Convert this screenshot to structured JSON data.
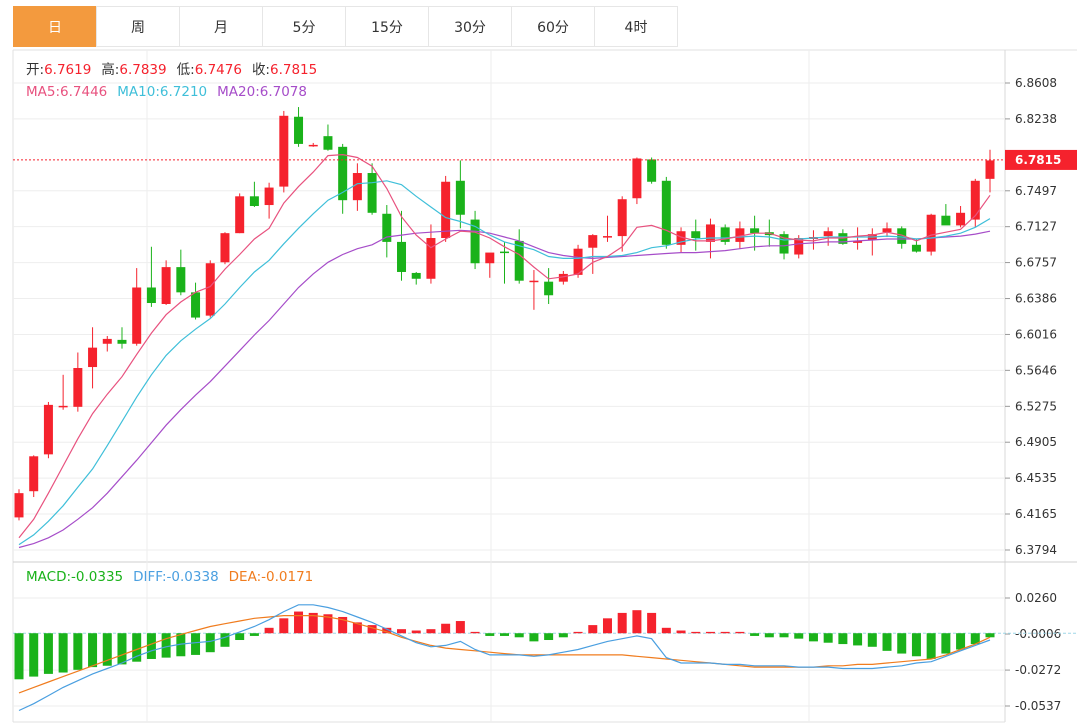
{
  "tabs": [
    {
      "label": "日",
      "active": true
    },
    {
      "label": "周",
      "active": false
    },
    {
      "label": "月",
      "active": false
    },
    {
      "label": "5分",
      "active": false
    },
    {
      "label": "15分",
      "active": false
    },
    {
      "label": "30分",
      "active": false
    },
    {
      "label": "60分",
      "active": false
    },
    {
      "label": "4时",
      "active": false
    }
  ],
  "colors": {
    "up": "#f5222d",
    "down": "#1ab21a",
    "ma5": "#e8527f",
    "ma10": "#3fbfd9",
    "ma20": "#a64dc9",
    "diff": "#4a9fe0",
    "dea": "#f07c1e",
    "grid": "#eeeeee",
    "tab_active": "#f39a3e"
  },
  "chart_data": [
    {
      "type": "candlestick",
      "ohlc_header": [
        {
          "label": "开:",
          "value": "6.7619"
        },
        {
          "label": "高:",
          "value": "6.7839"
        },
        {
          "label": "低:",
          "value": "6.7476"
        },
        {
          "label": "收:",
          "value": "6.7815"
        }
      ],
      "ma_header": [
        {
          "label": "MA5:",
          "value": "6.7446",
          "color": "#e8527f"
        },
        {
          "label": "MA10:",
          "value": "6.7210",
          "color": "#3fbfd9"
        },
        {
          "label": "MA20:",
          "value": "6.7078",
          "color": "#a64dc9"
        }
      ],
      "y_ticks": [
        "6.8608",
        "6.8238",
        "6.7497",
        "6.7127",
        "6.6757",
        "6.6386",
        "6.6016",
        "6.5646",
        "6.5275",
        "6.4905",
        "6.4535",
        "6.4165",
        "6.3794"
      ],
      "ylim": [
        6.3794,
        6.8608
      ],
      "last_price": "6.7815",
      "grid": true,
      "candles": [
        [
          6.413,
          6.442,
          6.41,
          6.438
        ],
        [
          6.44,
          6.477,
          6.434,
          6.476
        ],
        [
          6.478,
          6.532,
          6.474,
          6.529
        ],
        [
          6.528,
          6.56,
          6.524,
          6.528
        ],
        [
          6.527,
          6.583,
          6.522,
          6.567
        ],
        [
          6.568,
          6.609,
          6.546,
          6.588
        ],
        [
          6.592,
          6.6,
          6.584,
          6.597
        ],
        [
          6.596,
          6.609,
          6.587,
          6.592
        ],
        [
          6.592,
          6.67,
          6.59,
          6.65
        ],
        [
          6.65,
          6.692,
          6.63,
          6.634
        ],
        [
          6.633,
          6.678,
          6.632,
          6.671
        ],
        [
          6.671,
          6.689,
          6.642,
          6.645
        ],
        [
          6.645,
          6.655,
          6.617,
          6.619
        ],
        [
          6.621,
          6.678,
          6.619,
          6.675
        ],
        [
          6.676,
          6.707,
          6.674,
          6.706
        ],
        [
          6.706,
          6.747,
          6.706,
          6.744
        ],
        [
          6.744,
          6.759,
          6.733,
          6.734
        ],
        [
          6.735,
          6.758,
          6.721,
          6.753
        ],
        [
          6.754,
          6.832,
          6.748,
          6.827
        ],
        [
          6.826,
          6.836,
          6.795,
          6.798
        ],
        [
          6.797,
          6.799,
          6.795,
          6.797
        ],
        [
          6.806,
          6.818,
          6.791,
          6.792
        ],
        [
          6.795,
          6.798,
          6.726,
          6.74
        ],
        [
          6.74,
          6.778,
          6.729,
          6.768
        ],
        [
          6.768,
          6.778,
          6.725,
          6.727
        ],
        [
          6.726,
          6.735,
          6.681,
          6.697
        ],
        [
          6.697,
          6.729,
          6.657,
          6.666
        ],
        [
          6.665,
          6.666,
          6.653,
          6.659
        ],
        [
          6.659,
          6.715,
          6.654,
          6.701
        ],
        [
          6.701,
          6.765,
          6.697,
          6.759
        ],
        [
          6.76,
          6.781,
          6.711,
          6.725
        ],
        [
          6.72,
          6.729,
          6.669,
          6.675
        ],
        [
          6.675,
          6.683,
          6.66,
          6.686
        ],
        [
          6.687,
          6.697,
          6.654,
          6.686
        ],
        [
          6.698,
          6.71,
          6.654,
          6.657
        ],
        [
          6.656,
          6.668,
          6.627,
          6.657
        ],
        [
          6.656,
          6.67,
          6.633,
          6.642
        ],
        [
          6.656,
          6.667,
          6.653,
          6.664
        ],
        [
          6.663,
          6.694,
          6.66,
          6.69
        ],
        [
          6.691,
          6.705,
          6.664,
          6.704
        ],
        [
          6.702,
          6.724,
          6.697,
          6.703
        ],
        [
          6.703,
          6.744,
          6.687,
          6.741
        ],
        [
          6.742,
          6.784,
          6.736,
          6.783
        ],
        [
          6.782,
          6.784,
          6.757,
          6.759
        ],
        [
          6.76,
          6.764,
          6.69,
          6.694
        ],
        [
          6.694,
          6.712,
          6.686,
          6.708
        ],
        [
          6.708,
          6.72,
          6.688,
          6.701
        ],
        [
          6.697,
          6.721,
          6.68,
          6.715
        ],
        [
          6.712,
          6.715,
          6.694,
          6.697
        ],
        [
          6.697,
          6.718,
          6.69,
          6.711
        ],
        [
          6.711,
          6.724,
          6.688,
          6.706
        ],
        [
          6.707,
          6.72,
          6.692,
          6.704
        ],
        [
          6.705,
          6.708,
          6.679,
          6.685
        ],
        [
          6.684,
          6.704,
          6.68,
          6.701
        ],
        [
          6.7,
          6.709,
          6.689,
          6.702
        ],
        [
          6.703,
          6.712,
          6.693,
          6.708
        ],
        [
          6.706,
          6.71,
          6.694,
          6.695
        ],
        [
          6.696,
          6.712,
          6.689,
          6.698
        ],
        [
          6.699,
          6.711,
          6.683,
          6.705
        ],
        [
          6.707,
          6.717,
          6.702,
          6.711
        ],
        [
          6.711,
          6.713,
          6.69,
          6.695
        ],
        [
          6.694,
          6.7,
          6.686,
          6.687
        ],
        [
          6.687,
          6.726,
          6.683,
          6.725
        ],
        [
          6.724,
          6.736,
          6.716,
          6.714
        ],
        [
          6.714,
          6.734,
          6.712,
          6.727
        ],
        [
          6.72,
          6.762,
          6.712,
          6.76
        ],
        [
          6.762,
          6.792,
          6.748,
          6.781
        ]
      ],
      "ma5": [
        6.392,
        6.411,
        6.438,
        6.466,
        6.494,
        6.52,
        6.54,
        6.558,
        6.581,
        6.603,
        6.622,
        6.635,
        6.645,
        6.651,
        6.669,
        6.684,
        6.7,
        6.711,
        6.737,
        6.754,
        6.769,
        6.786,
        6.787,
        6.784,
        6.775,
        6.752,
        6.723,
        6.704,
        6.691,
        6.7,
        6.708,
        6.707,
        6.701,
        6.692,
        6.684,
        6.671,
        6.659,
        6.661,
        6.664,
        6.676,
        6.682,
        6.692,
        6.712,
        6.714,
        6.709,
        6.702,
        6.698,
        6.698,
        6.7,
        6.703,
        6.706,
        6.706,
        6.701,
        6.699,
        6.698,
        6.701,
        6.701,
        6.703,
        6.704,
        6.707,
        6.704,
        6.698,
        6.704,
        6.707,
        6.71,
        6.724,
        6.745
      ],
      "ma10": [
        6.385,
        6.395,
        6.409,
        6.425,
        6.444,
        6.463,
        6.487,
        6.512,
        6.537,
        6.56,
        6.58,
        6.595,
        6.607,
        6.618,
        6.633,
        6.65,
        6.666,
        6.678,
        6.695,
        6.711,
        6.726,
        6.74,
        6.748,
        6.757,
        6.758,
        6.76,
        6.756,
        6.744,
        6.733,
        6.722,
        6.718,
        6.713,
        6.704,
        6.697,
        6.693,
        6.689,
        6.682,
        6.68,
        6.68,
        6.682,
        6.682,
        6.683,
        6.686,
        6.691,
        6.693,
        6.697,
        6.7,
        6.701,
        6.701,
        6.702,
        6.703,
        6.702,
        6.699,
        6.7,
        6.701,
        6.702,
        6.702,
        6.702,
        6.702,
        6.703,
        6.702,
        6.7,
        6.701,
        6.703,
        6.706,
        6.712,
        6.721
      ],
      "ma20": [
        6.382,
        6.386,
        6.392,
        6.4,
        6.411,
        6.423,
        6.438,
        6.455,
        6.472,
        6.49,
        6.508,
        6.524,
        6.539,
        6.553,
        6.569,
        6.585,
        6.601,
        6.616,
        6.633,
        6.65,
        6.664,
        6.676,
        6.684,
        6.69,
        6.694,
        6.702,
        6.704,
        6.706,
        6.707,
        6.708,
        6.709,
        6.708,
        6.706,
        6.702,
        6.698,
        6.692,
        6.686,
        6.683,
        6.681,
        6.68,
        6.681,
        6.682,
        6.683,
        6.684,
        6.685,
        6.686,
        6.686,
        6.687,
        6.688,
        6.69,
        6.692,
        6.693,
        6.693,
        6.695,
        6.696,
        6.697,
        6.697,
        6.698,
        6.699,
        6.7,
        6.7,
        6.7,
        6.701,
        6.702,
        6.703,
        6.705,
        6.708
      ]
    },
    {
      "type": "bar",
      "header": [
        {
          "label": "MACD:",
          "value": "-0.0335",
          "color": "#1ab21a"
        },
        {
          "label": "DIFF:",
          "value": "-0.0338",
          "color": "#4a9fe0"
        },
        {
          "label": "DEA:",
          "value": "-0.0171",
          "color": "#f07c1e"
        }
      ],
      "y_ticks": [
        "0.0260",
        "-0.0006",
        "-0.0272",
        "-0.0537"
      ],
      "ylim": [
        -0.0537,
        0.026
      ],
      "grid": true,
      "macd": [
        -0.034,
        -0.032,
        -0.03,
        -0.029,
        -0.027,
        -0.025,
        -0.024,
        -0.023,
        -0.021,
        -0.019,
        -0.018,
        -0.017,
        -0.016,
        -0.014,
        -0.01,
        -0.005,
        -0.002,
        0.004,
        0.011,
        0.016,
        0.015,
        0.014,
        0.012,
        0.008,
        0.006,
        0.004,
        0.003,
        0.002,
        0.003,
        0.007,
        0.009,
        0.001,
        -0.002,
        -0.002,
        -0.003,
        -0.006,
        -0.005,
        -0.003,
        0.001,
        0.006,
        0.011,
        0.015,
        0.017,
        0.015,
        0.004,
        0.002,
        0.001,
        0.001,
        0.001,
        0.001,
        -0.002,
        -0.003,
        -0.003,
        -0.004,
        -0.006,
        -0.007,
        -0.008,
        -0.009,
        -0.01,
        -0.013,
        -0.015,
        -0.017,
        -0.019,
        -0.015,
        -0.012,
        -0.008,
        -0.003
      ],
      "diff": [
        -0.057,
        -0.052,
        -0.046,
        -0.04,
        -0.035,
        -0.03,
        -0.026,
        -0.022,
        -0.017,
        -0.013,
        -0.01,
        -0.008,
        -0.007,
        -0.006,
        -0.003,
        0.001,
        0.005,
        0.01,
        0.016,
        0.021,
        0.021,
        0.019,
        0.016,
        0.012,
        0.008,
        0.003,
        -0.002,
        -0.007,
        -0.01,
        -0.009,
        -0.006,
        -0.012,
        -0.016,
        -0.016,
        -0.016,
        -0.017,
        -0.016,
        -0.014,
        -0.012,
        -0.009,
        -0.006,
        -0.004,
        -0.002,
        -0.004,
        -0.018,
        -0.022,
        -0.022,
        -0.022,
        -0.023,
        -0.023,
        -0.024,
        -0.024,
        -0.024,
        -0.025,
        -0.025,
        -0.025,
        -0.026,
        -0.026,
        -0.026,
        -0.025,
        -0.024,
        -0.022,
        -0.021,
        -0.017,
        -0.013,
        -0.009,
        -0.005
      ],
      "dea": [
        -0.044,
        -0.04,
        -0.036,
        -0.032,
        -0.028,
        -0.024,
        -0.02,
        -0.016,
        -0.012,
        -0.008,
        -0.004,
        -0.001,
        0.002,
        0.005,
        0.007,
        0.009,
        0.011,
        0.012,
        0.013,
        0.013,
        0.013,
        0.012,
        0.01,
        0.007,
        0.004,
        0.001,
        -0.003,
        -0.006,
        -0.009,
        -0.011,
        -0.012,
        -0.013,
        -0.014,
        -0.015,
        -0.016,
        -0.016,
        -0.016,
        -0.016,
        -0.016,
        -0.016,
        -0.016,
        -0.016,
        -0.017,
        -0.018,
        -0.019,
        -0.02,
        -0.021,
        -0.022,
        -0.023,
        -0.024,
        -0.025,
        -0.025,
        -0.025,
        -0.025,
        -0.025,
        -0.024,
        -0.024,
        -0.023,
        -0.023,
        -0.022,
        -0.021,
        -0.02,
        -0.019,
        -0.016,
        -0.012,
        -0.008,
        -0.003
      ]
    }
  ]
}
